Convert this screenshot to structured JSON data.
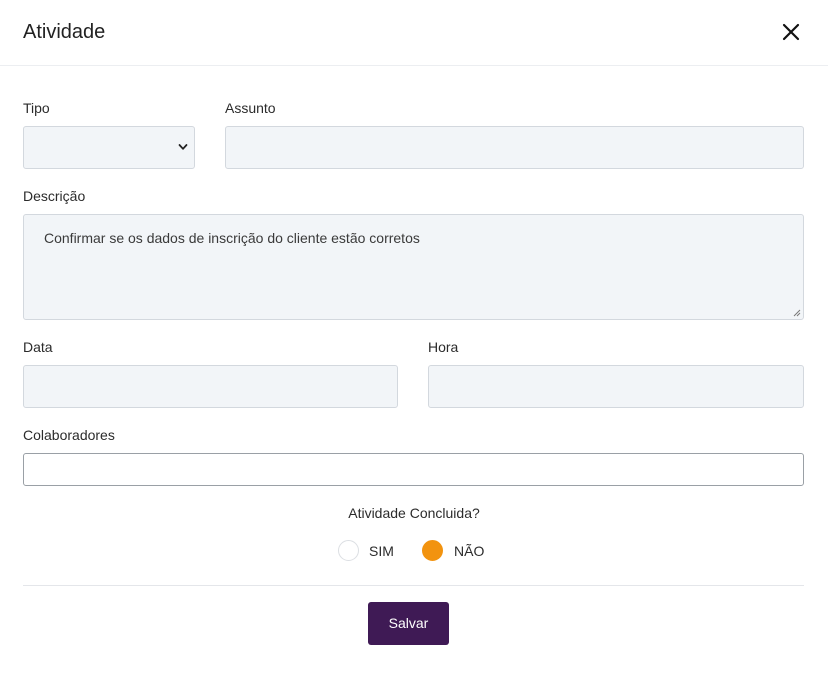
{
  "modal": {
    "title": "Atividade",
    "close_icon": "close-icon"
  },
  "form": {
    "tipo": {
      "label": "Tipo",
      "value": ""
    },
    "assunto": {
      "label": "Assunto",
      "value": ""
    },
    "descricao": {
      "label": "Descrição",
      "value": "Confirmar se os dados de inscrição do cliente estão corretos"
    },
    "data": {
      "label": "Data",
      "value": ""
    },
    "hora": {
      "label": "Hora",
      "value": ""
    },
    "colaboradores": {
      "label": "Colaboradores",
      "value": ""
    },
    "concluida": {
      "question": "Atividade Concluida?",
      "options": [
        {
          "label": "SIM",
          "selected": false
        },
        {
          "label": "NÃO",
          "selected": true
        }
      ]
    }
  },
  "footer": {
    "save_label": "Salvar"
  },
  "colors": {
    "accent_radio": "#f2930f",
    "primary_button": "#3f1a55",
    "field_bg": "#f2f5f8"
  }
}
